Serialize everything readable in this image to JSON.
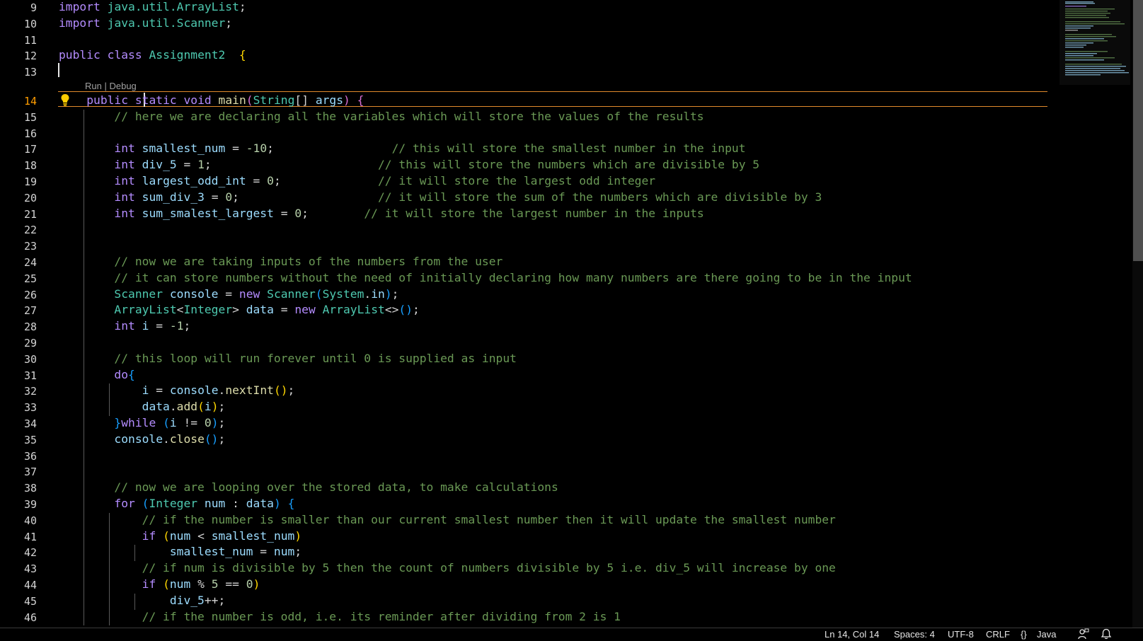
{
  "editor": {
    "line_numbers": [
      "9",
      "10",
      "11",
      "12",
      "13",
      "14",
      "15",
      "16",
      "17",
      "18",
      "19",
      "20",
      "21",
      "22",
      "23",
      "24",
      "25",
      "26",
      "27",
      "28",
      "29",
      "30",
      "31",
      "32",
      "33",
      "34",
      "35",
      "36",
      "37",
      "38",
      "39",
      "40",
      "41",
      "42",
      "43",
      "44",
      "45",
      "46"
    ],
    "active_line": "14",
    "codelens": {
      "run": "Run",
      "separator": " | ",
      "debug": "Debug"
    },
    "tokens": {
      "import": "import",
      "public": "public",
      "class": "class",
      "static": "static",
      "void": "void",
      "int": "int",
      "new": "new",
      "do": "do",
      "while": "while",
      "for": "for",
      "if": "if",
      "java_util_arraylist": "java.util.ArrayList",
      "java_util_scanner": "java.util.Scanner",
      "Assignment2": "Assignment2",
      "main": "main",
      "String": "String",
      "args": "args",
      "smallest_num": "smallest_num",
      "div_5": "div_5",
      "largest_odd_int": "largest_odd_int",
      "sum_div_3": "sum_div_3",
      "sum_smalest_largest": "sum_smalest_largest",
      "Scanner": "Scanner",
      "console": "console",
      "System": "System",
      "in": "in",
      "ArrayList": "ArrayList",
      "Integer": "Integer",
      "data": "data",
      "i": "i",
      "nextInt": "nextInt",
      "add": "add",
      "close": "close",
      "num": "num",
      "n_m10": "-10",
      "n_1": "1",
      "n_0": "0",
      "n_m1": "-1",
      "n_5": "5",
      "c15": "// here we are declaring all the variables which will store the values of the results",
      "c17": "// this will store the smallest number in the input",
      "c18": "// this will store the numbers which are divisible by 5",
      "c19": "// it will store the largest odd integer",
      "c20": "// it will store the sum of the numbers which are divisible by 3",
      "c21": "// it will store the largest number in the inputs",
      "c24": "// now we are taking inputs of the numbers from the user",
      "c25": "// it can store numbers without the need of initially declaring how many numbers are there going to be in the input",
      "c30": "// this loop will run forever until 0 is supplied as input",
      "c38": "// now we are looping over the stored data, to make calculations",
      "c40": "// if the number is smaller than our current smallest number then it will update the smallest number",
      "c43": "// if num is divisible by 5 then the count of numbers divisible by 5 i.e. div_5 will increase by one",
      "c46": "// if the number is odd, i.e. its reminder after dividing from 2 is 1"
    }
  },
  "statusbar": {
    "position": "Ln 14, Col 14",
    "spaces": "Spaces: 4",
    "encoding": "UTF-8",
    "eol": "CRLF",
    "language_icon": "{}",
    "language": "Java",
    "feedback_icon": "person-feedback-icon",
    "notifications_icon": "bell-icon"
  },
  "colors": {
    "keyword": "#b48cff",
    "type": "#4ec9b0",
    "variable": "#9cdcfe",
    "function": "#dcdcaa",
    "number": "#b5cea8",
    "comment": "#6a9955",
    "line_number": "#d4d4d4",
    "active_line_number": "#ff9d00",
    "current_line_border": "#e08a2c",
    "bulb": "#ffcc00"
  }
}
